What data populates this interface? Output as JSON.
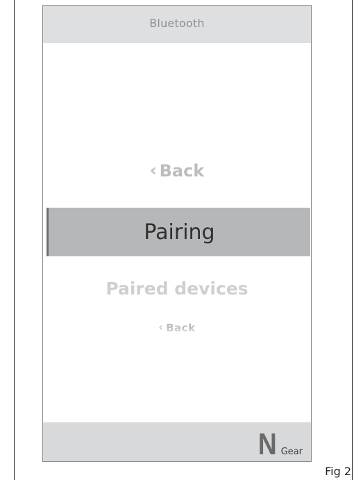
{
  "header": {
    "title": "Bluetooth"
  },
  "menu": {
    "back_top": {
      "icon": "chevron-left-icon",
      "chevron": "‹",
      "label": "Back"
    },
    "selected": {
      "label": "Pairing"
    },
    "paired": {
      "label": "Paired devices"
    },
    "back_small": {
      "icon": "chevron-left-icon",
      "chevron": "‹",
      "label": "Back"
    }
  },
  "footer": {
    "gear_value": "N",
    "gear_label": "Gear"
  },
  "figure": {
    "caption": "Fig 2"
  },
  "colors": {
    "header_bg": "#dedfe1",
    "selected_bg": "#b6b7b9",
    "footer_bg": "#d8d9db",
    "inactive_text": "#bdbdbd"
  }
}
